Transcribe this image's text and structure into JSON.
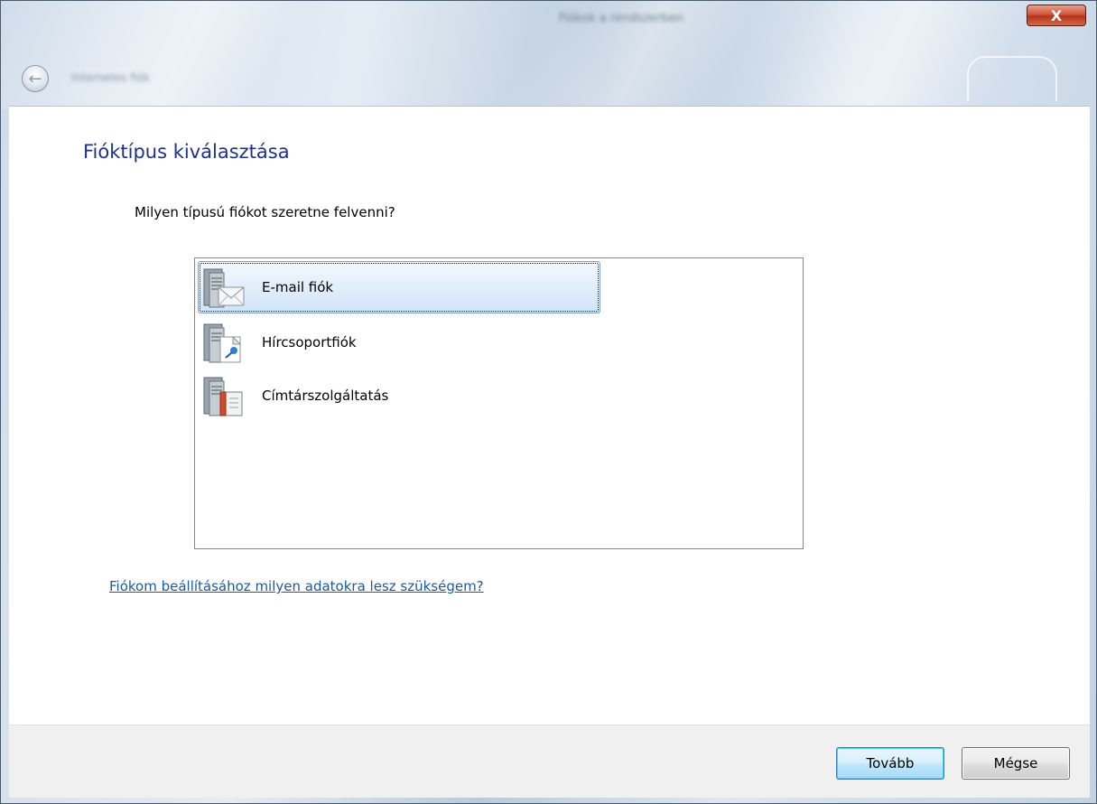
{
  "window": {
    "title": "Fiókok a rendszerben",
    "close_label": "X",
    "nav_title": "Internetes fiók",
    "back_icon": "←"
  },
  "main": {
    "page_title": "Fióktípus kiválasztása",
    "prompt": "Milyen típusú fiókot szeretne felvenni?",
    "account_types": [
      {
        "label": "E-mail fiók",
        "icon": "mail-server-icon",
        "selected": true
      },
      {
        "label": "Hírcsoportfiók",
        "icon": "newsgroup-server-icon",
        "selected": false
      },
      {
        "label": "Címtárszolgáltatás",
        "icon": "directory-server-icon",
        "selected": false
      }
    ],
    "help_link": "Fiókom beállításához milyen adatokra lesz szükségem?"
  },
  "footer": {
    "next_label": "Tovább",
    "cancel_label": "Mégse"
  },
  "colors": {
    "title_blue": "#1e3287",
    "link_blue": "#1a5aa0",
    "selection": "#cfe4fa",
    "close_red": "#c8452a"
  }
}
